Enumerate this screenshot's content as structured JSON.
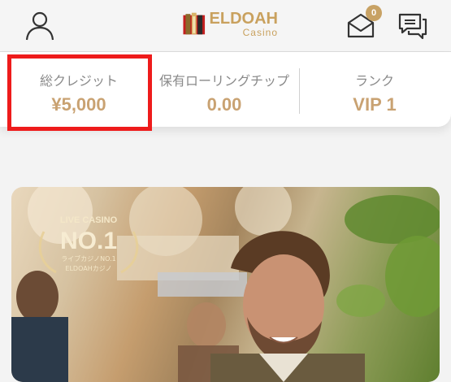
{
  "header": {
    "logo_title": "ELDOAH",
    "logo_subtitle": "Casino",
    "mail_badge": "0",
    "icons": [
      "user-icon",
      "mail-icon",
      "chat-icon"
    ]
  },
  "stats": [
    {
      "label": "総クレジット",
      "value": "¥5,000"
    },
    {
      "label": "保有ローリングチップ",
      "value": "0.00"
    },
    {
      "label": "ランク",
      "value": "VIP 1"
    }
  ],
  "banner": {
    "badge_top": "LIVE CASINO",
    "badge_main": "NO.1",
    "badge_sub1": "ライブカジノNO.1",
    "badge_sub2": "ELDOAHカジノ"
  },
  "colors": {
    "accent": "#c9a272",
    "highlight": "#ee1b1b"
  }
}
